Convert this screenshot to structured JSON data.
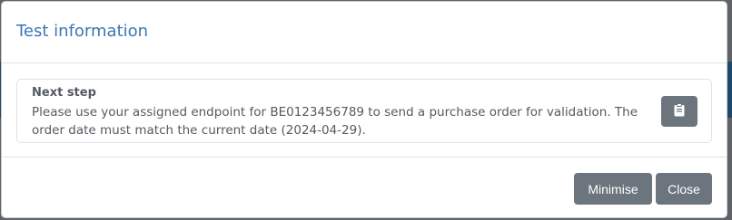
{
  "modal": {
    "title": "Test information",
    "step": {
      "title": "Next step",
      "text": "Please use your assigned endpoint for BE0123456789 to send a purchase order for validation. The order date must match the current date (2024-04-29).",
      "copy_icon": "clipboard-icon"
    },
    "footer": {
      "minimise_label": "Minimise",
      "close_label": "Close"
    }
  },
  "colors": {
    "title": "#3a78b5",
    "button": "#6c757d",
    "text": "#555a60"
  }
}
